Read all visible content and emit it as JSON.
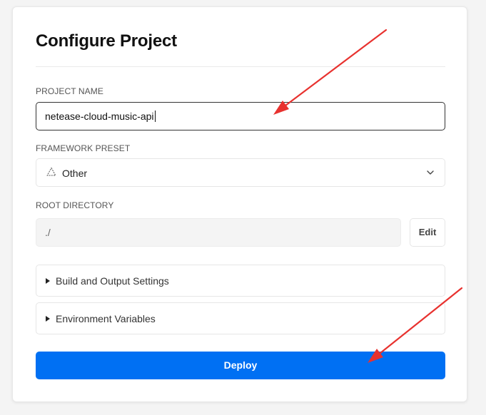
{
  "page": {
    "title": "Configure Project"
  },
  "project_name": {
    "label": "PROJECT NAME",
    "value": "netease-cloud-music-api"
  },
  "framework_preset": {
    "label": "FRAMEWORK PRESET",
    "selected": "Other",
    "icon": "triangle-outline-icon"
  },
  "root_directory": {
    "label": "ROOT DIRECTORY",
    "value": "./",
    "edit_label": "Edit"
  },
  "sections": [
    {
      "label": "Build and Output Settings"
    },
    {
      "label": "Environment Variables"
    }
  ],
  "actions": {
    "deploy_label": "Deploy"
  },
  "colors": {
    "accent": "#0070f3",
    "annotation_arrow": "#e8322f"
  }
}
